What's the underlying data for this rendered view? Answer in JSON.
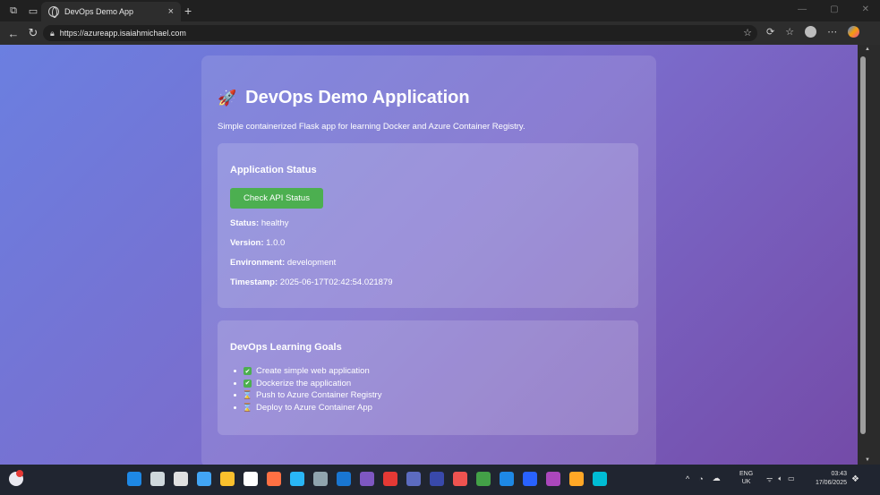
{
  "browser": {
    "tab_title": "DevOps Demo App",
    "tab_close": "×",
    "new_tab": "+",
    "url": "https://azureapp.isaiahmichael.com",
    "window_controls": [
      "—",
      "▢",
      "✕"
    ]
  },
  "page": {
    "title_icon": "🚀",
    "title": "DevOps Demo Application",
    "subtitle": "Simple containerized Flask app for learning Docker and Azure Container Registry."
  },
  "status_card": {
    "heading": "Application Status",
    "button_label": "Check API Status",
    "fields": [
      {
        "label": "Status:",
        "value": "healthy"
      },
      {
        "label": "Version:",
        "value": "1.0.0"
      },
      {
        "label": "Environment:",
        "value": "development"
      },
      {
        "label": "Timestamp:",
        "value": "2025-06-17T02:42:54.021879"
      }
    ]
  },
  "goals_card": {
    "heading": "DevOps Learning Goals",
    "items": [
      {
        "text": "Create simple web application",
        "mark": "✔"
      },
      {
        "text": "Dockerize the application",
        "mark": "✔"
      },
      {
        "text": "Push to Azure Container Registry",
        "mark": "⌛"
      },
      {
        "text": "Deploy to Azure Container App",
        "mark": "⌛"
      }
    ]
  },
  "taskbar": {
    "lang_line1": "ENG",
    "lang_line2": "UK",
    "time": "03:43",
    "date": "17/06/2025",
    "app_colors": [
      "#1e88e5",
      "#cfd8dc",
      "#e0e0e0",
      "#42a5f5",
      "#fbc02d",
      "#ffffff",
      "#ff7043",
      "#29b6f6",
      "#90a4ae",
      "#1976d2",
      "#7e57c2",
      "#e53935",
      "#5c6bc0",
      "#3949ab",
      "#ef5350",
      "#43a047",
      "#1e88e5",
      "#2962ff",
      "#ab47bc",
      "#ffa726",
      "#00bcd4"
    ]
  }
}
